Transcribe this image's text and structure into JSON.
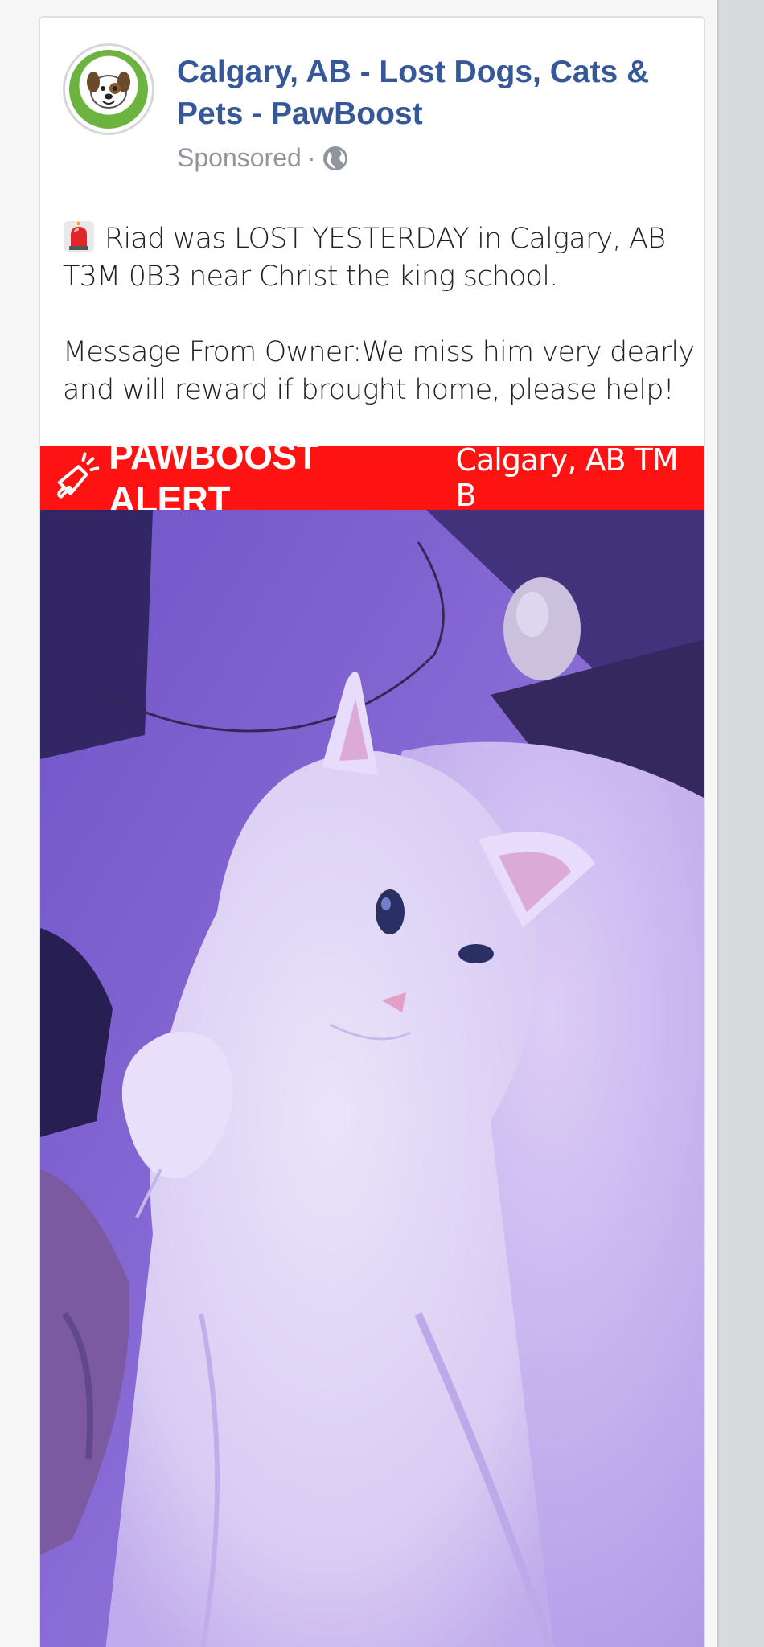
{
  "post": {
    "page_name": "Calgary, AB - Lost Dogs, Cats & Pets - PawBoost",
    "sponsored_label": "Sponsored",
    "separator": "·",
    "paragraph1": "Riad was LOST YESTERDAY in Calgary, AB T3M 0B3 near Christ the king school.",
    "paragraph2": "Message From Owner:We miss him very dearly and will reward if brought home, please help!"
  },
  "alert_banner": {
    "title": "PAWBOOST ALERT",
    "location": "Calgary, AB TM B"
  },
  "icons": {
    "avatar": "pawboost-logo-icon",
    "privacy": "globe-icon",
    "prefix": "siren-icon",
    "banner": "megaphone-icon"
  },
  "colors": {
    "page_name": "#365899",
    "banner_bg": "#ff1212",
    "muted_text": "#90949c",
    "photo_tint": "#8c6fd6"
  }
}
